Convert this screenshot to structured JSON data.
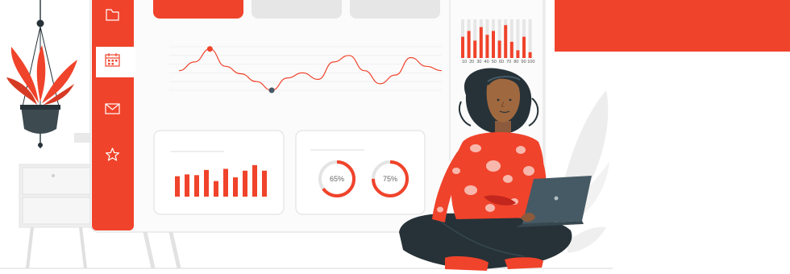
{
  "colors": {
    "accent": "#f0432b",
    "accent_dark": "#d63a24",
    "panel_border": "#e3e3e3",
    "panel_fill": "#f7f7f7",
    "ink": "#263238",
    "grey_line": "#dedede"
  },
  "sidebar": {
    "items": [
      {
        "icon": "folder-icon",
        "active": false
      },
      {
        "icon": "calendar-icon",
        "active": true
      },
      {
        "icon": "mail-icon",
        "active": false
      },
      {
        "icon": "star-icon",
        "active": false
      }
    ]
  },
  "line_chart": {
    "y": [
      0.55,
      0.35,
      0.05,
      0.45,
      0.62,
      0.8,
      1.0,
      0.72,
      0.6,
      0.75,
      0.35,
      0.2,
      0.55,
      0.85,
      0.65,
      0.25,
      0.45,
      0.55
    ],
    "highlight": [
      2,
      6
    ]
  },
  "mini_bars": {
    "values": [
      0.55,
      0.6,
      0.58,
      0.72,
      0.42,
      0.75,
      0.52,
      0.7,
      0.85,
      0.7
    ]
  },
  "donuts": [
    {
      "label": "65%",
      "value": 0.65
    },
    {
      "label": "75%",
      "value": 0.75
    }
  ],
  "side_bars": {
    "labels": [
      "10",
      "20",
      "30",
      "40",
      "50",
      "60",
      "70",
      "80",
      "90",
      "100"
    ],
    "values": [
      0.55,
      0.7,
      0.45,
      0.8,
      0.6,
      0.7,
      0.45,
      0.85,
      0.42,
      0.2,
      0.55,
      0.15
    ]
  }
}
